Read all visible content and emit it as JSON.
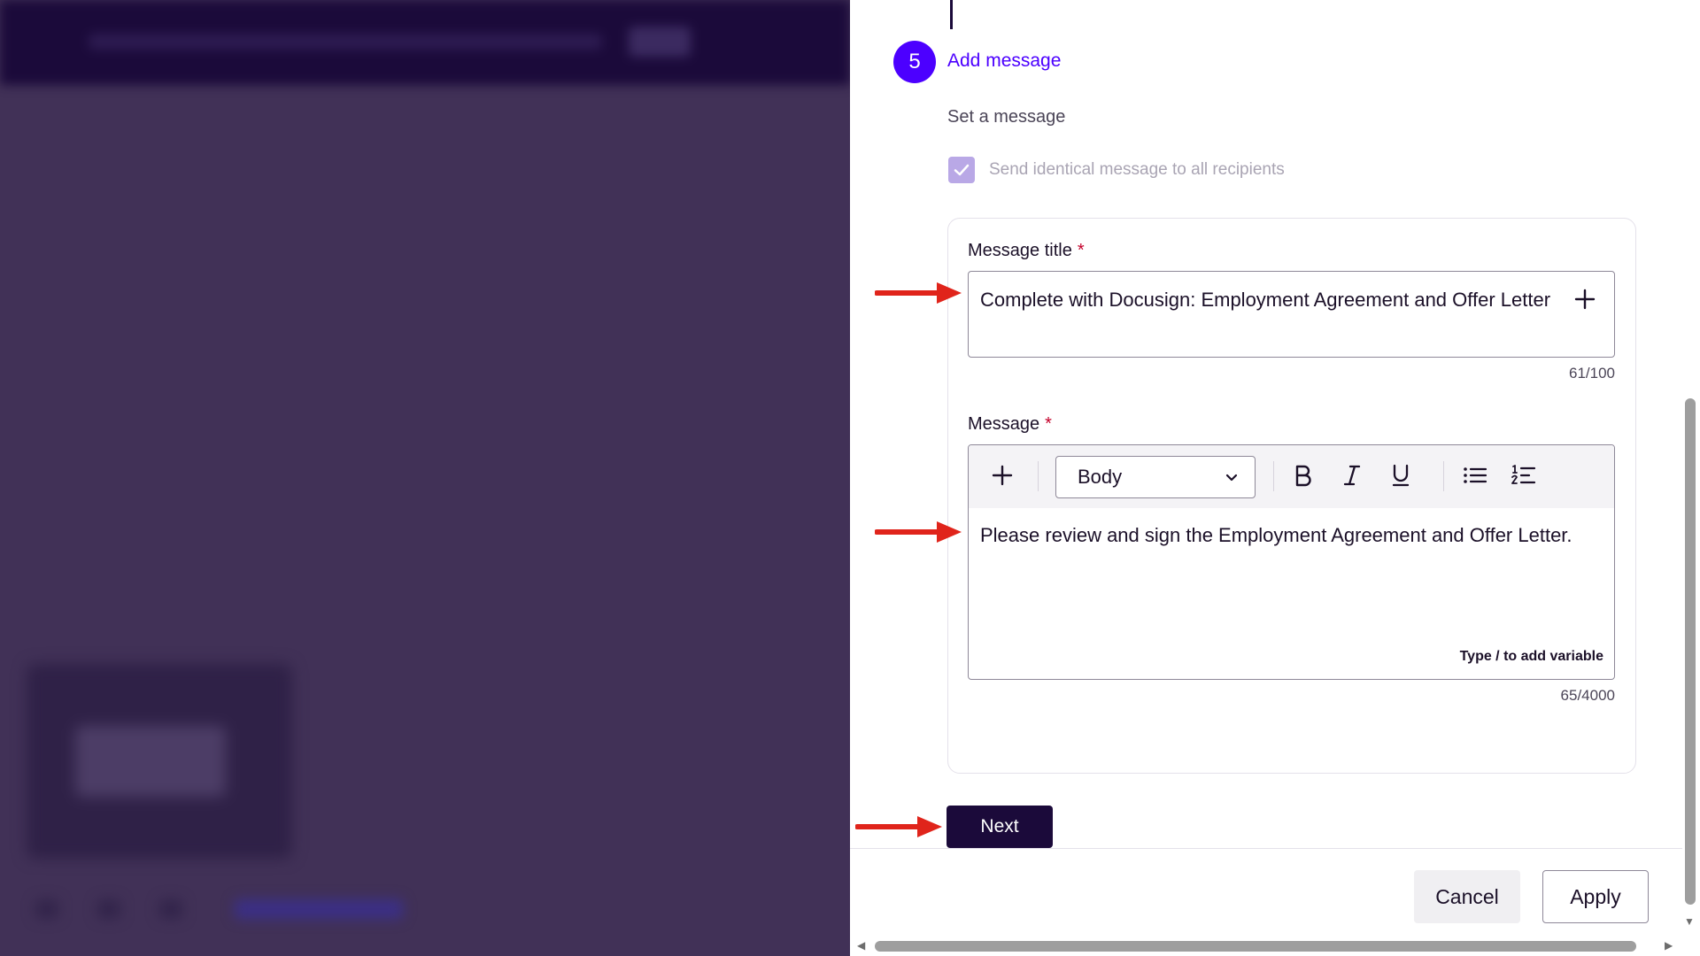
{
  "step": {
    "number": "5",
    "title": "Add message",
    "subtitle": "Set a message"
  },
  "identical_checkbox": {
    "label": "Send identical message to all recipients",
    "checked": true
  },
  "message_title": {
    "label": "Message title",
    "required_mark": "*",
    "value": "Complete with Docusign: Employment Agreement and Offer Letter",
    "counter": "61/100"
  },
  "message": {
    "label": "Message",
    "required_mark": "*",
    "style_select": "Body",
    "value": "Please review and sign the Employment Agreement and Offer Letter.",
    "hint": "Type / to add variable",
    "counter": "65/4000"
  },
  "buttons": {
    "next": "Next",
    "cancel": "Cancel",
    "apply": "Apply"
  },
  "colors": {
    "accent": "#4c00ff",
    "primary_dark": "#1b0a3a",
    "annotation_arrow": "#e0241b"
  }
}
